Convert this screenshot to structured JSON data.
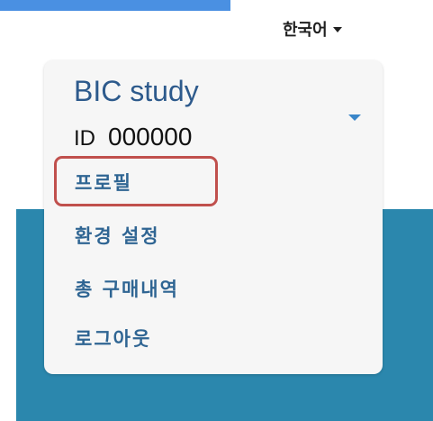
{
  "header": {
    "language_label": "한국어"
  },
  "account_menu": {
    "title": "BIC study",
    "id_label": "ID",
    "id_value": "000000",
    "items": [
      {
        "label": "프로필"
      },
      {
        "label": "환경 설정"
      },
      {
        "label": "총 구매내역"
      },
      {
        "label": "로그아웃"
      }
    ]
  },
  "colors": {
    "top_bar": "#4a90e2",
    "panel_background": "#2b87ad",
    "menu_text": "#2f6593",
    "highlight_border": "#c0504d",
    "card_background": "#f6f6f6"
  },
  "icons": {
    "language_caret": "caret-down-icon",
    "menu_toggle": "triangle-down-icon"
  }
}
